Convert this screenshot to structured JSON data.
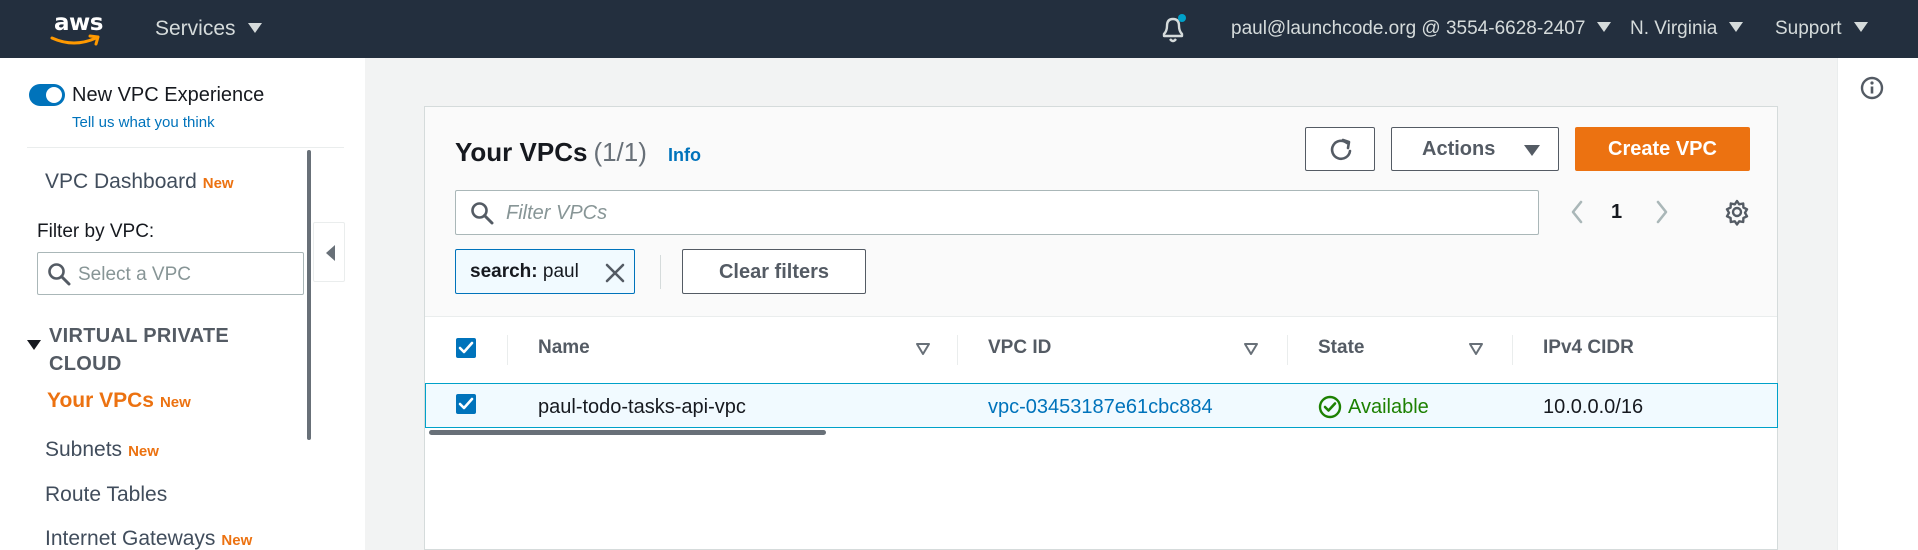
{
  "topnav": {
    "logo_text": "aws",
    "services_label": "Services",
    "account_label": "paul@launchcode.org @ 3554-6628-2407",
    "region_label": "N. Virginia",
    "support_label": "Support",
    "icons": [
      "bell-icon",
      "chevron-down-icon"
    ],
    "colors": {
      "background": "#232f3e",
      "notification_dot": "#00a1c9"
    }
  },
  "sidebar": {
    "experience_toggle_label": "New VPC Experience",
    "experience_toggle_on": true,
    "feedback_link": "Tell us what you think",
    "dashboard_label": "VPC Dashboard",
    "new_badge": "New",
    "filter_label": "Filter by VPC:",
    "filter_placeholder": "Select a VPC",
    "section_title": "VIRTUAL PRIVATE CLOUD",
    "items": [
      {
        "label": "Your VPCs",
        "badge": "New",
        "active": true
      },
      {
        "label": "Subnets",
        "badge": "New",
        "active": false
      },
      {
        "label": "Route Tables",
        "badge": "",
        "active": false
      },
      {
        "label": "Internet Gateways",
        "badge": "New",
        "active": false
      }
    ]
  },
  "main": {
    "title": "Your VPCs",
    "count": "(1/1)",
    "info_link": "Info",
    "refresh_icon": "refresh-icon",
    "actions_label": "Actions",
    "create_label": "Create VPC",
    "filter_placeholder": "Filter VPCs",
    "filter_value": "",
    "page_number": "1",
    "token": {
      "key": "search:",
      "value": "paul"
    },
    "clear_filters_label": "Clear filters",
    "table": {
      "columns": [
        "Name",
        "VPC ID",
        "State",
        "IPv4 CIDR"
      ],
      "rows": [
        {
          "selected": true,
          "name": "paul-todo-tasks-api-vpc",
          "vpc_id": "vpc-03453187e61cbc884",
          "state": "Available",
          "ipv4_cidr": "10.0.0.0/16"
        }
      ]
    },
    "colors": {
      "primary_button": "#ec7211",
      "link": "#0073bb",
      "status_available": "#1d8102"
    }
  }
}
